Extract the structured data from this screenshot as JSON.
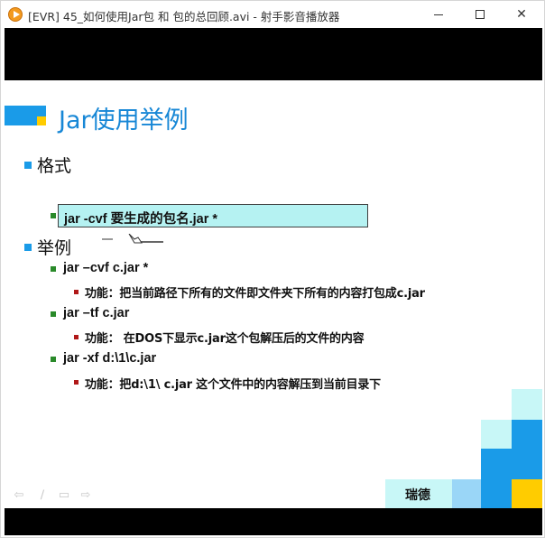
{
  "window": {
    "title": "[EVR] 45_如何使用Jar包 和 包的总回顾.avi - 射手影音播放器",
    "icon": "player-logo-icon",
    "controls": {
      "minimize_icon": "minimize-icon",
      "maximize_icon": "maximize-icon",
      "close_icon": "close-icon",
      "close_glyph": "✕"
    }
  },
  "slide": {
    "title": "Jar使用举例",
    "sections": [
      {
        "heading": "格式",
        "format_box": "jar  -cvf   要生成的包名.jar  *"
      },
      {
        "heading": "举例",
        "examples": [
          {
            "command": "jar –cvf   c.jar   *",
            "note": "功能：把当前路径下所有的文件即文件夹下所有的内容打包成c.jar"
          },
          {
            "command": "jar –tf c.jar",
            "note": "功能：  在DOS下显示c.jar这个包解压后的文件的内容"
          },
          {
            "command": "jar -xf d:\\1\\c.jar",
            "note": "功能：把d:\\1\\ c.jar 这个文件中的内容解压到当前目录下"
          }
        ]
      }
    ],
    "footer": {
      "company": "瑞德",
      "nav_icons": [
        "arrow-left-icon",
        "pen-icon",
        "menu-icon",
        "arrow-right-icon"
      ],
      "nav_glyphs": [
        "⇦",
        "∕",
        "▭",
        "⇨"
      ]
    },
    "colors": {
      "title": "#1787d6",
      "bullet_level1": "#1a9be8",
      "bullet_level2": "#2a8a2a",
      "bullet_level3": "#b01818",
      "format_box_bg": "#b5f2f2",
      "accent_yellow": "#ffcc00",
      "block_blue": "#1a9be8",
      "block_light": "#c8f7f7"
    }
  }
}
